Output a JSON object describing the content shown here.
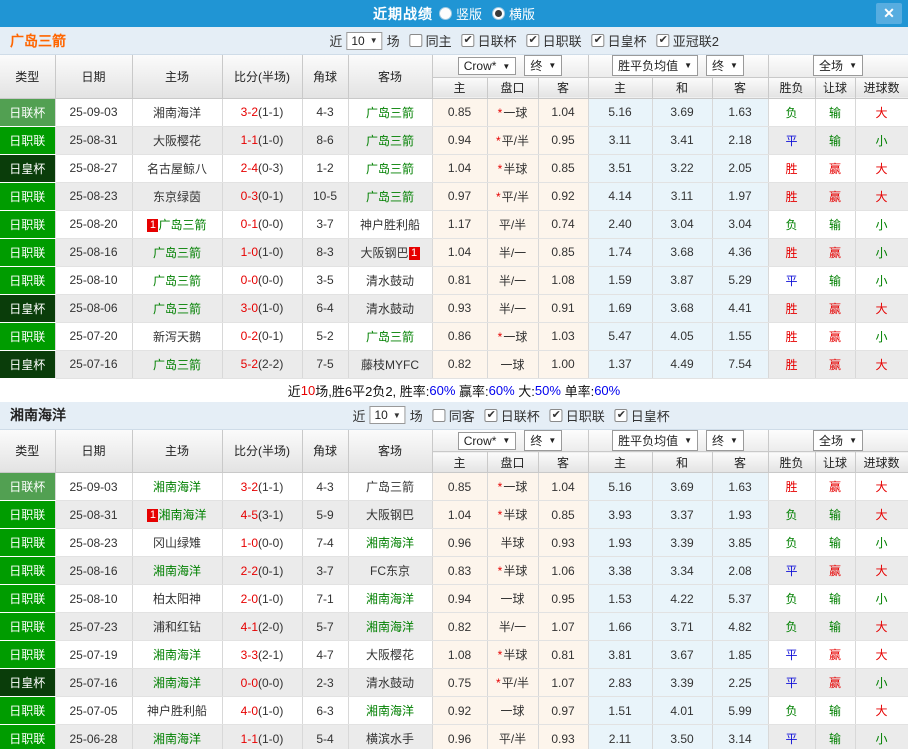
{
  "colors": {
    "titlebar_bg": "#2095d4",
    "close_bg": "#57ade0",
    "filterbar_bg": "#e5eef6",
    "team1_accent": "#ff6600",
    "team2_accent": "#222222",
    "cup1_green": "#52a052",
    "league_green": "#009c00",
    "cup2_darkgreen": "#0a3d0a",
    "crow_col_bg": "#fdf5ec",
    "avg_col_bg": "#e9f4fa",
    "win_red": "#e60000",
    "draw_blue": "#1010d8",
    "lose_green": "#008000"
  },
  "titlebar": {
    "title": "近期战绩",
    "close": "✕",
    "options": [
      {
        "label": "竖版",
        "selected": false
      },
      {
        "label": "横版",
        "selected": true
      }
    ]
  },
  "table_header": {
    "left_cols": [
      "类型",
      "日期",
      "主场",
      "比分(半场)",
      "角球",
      "客场"
    ],
    "group1": {
      "company": "Crow*",
      "final": "终"
    },
    "group2": {
      "company": "胜平负均值",
      "final": "终"
    },
    "group3": {
      "scope": "全场"
    },
    "sub_cols": [
      "主",
      "盘口",
      "客",
      "主",
      "和",
      "客",
      "胜负",
      "让球",
      "进球数"
    ]
  },
  "sections": [
    {
      "team": "广岛三箭",
      "team_color": "#ff6600",
      "filter": {
        "near": "近",
        "count": "10",
        "games": "场",
        "same": "同主",
        "same_checked": false,
        "leagues": [
          {
            "label": "日联杯",
            "checked": true
          },
          {
            "label": "日职联",
            "checked": true
          },
          {
            "label": "日皇杯",
            "checked": true
          },
          {
            "label": "亚冠联2",
            "checked": true
          }
        ]
      },
      "rows": [
        {
          "type": "日联杯",
          "tc": "cup1",
          "date": "25-09-03",
          "home": "湘南海洋",
          "hf": false,
          "hb": "",
          "score": "3-2",
          "half": "(1-1)",
          "corner": "4-3",
          "away": "广岛三箭",
          "af": true,
          "ab": "",
          "c1": "0.85",
          "star": true,
          "hc": "一球",
          "c2": "1.04",
          "a1": "5.16",
          "a2": "3.69",
          "a3": "1.63",
          "r": "负",
          "hr": "输",
          "g": "大"
        },
        {
          "type": "日职联",
          "tc": "lg",
          "date": "25-08-31",
          "home": "大阪樱花",
          "hf": false,
          "hb": "",
          "score": "1-1",
          "half": "(1-0)",
          "corner": "8-6",
          "away": "广岛三箭",
          "af": true,
          "ab": "",
          "c1": "0.94",
          "star": true,
          "hc": "平/半",
          "c2": "0.95",
          "a1": "3.11",
          "a2": "3.41",
          "a3": "2.18",
          "r": "平",
          "hr": "输",
          "g": "小"
        },
        {
          "type": "日皇杯",
          "tc": "cup2",
          "date": "25-08-27",
          "home": "名古屋鲸八",
          "hf": false,
          "hb": "",
          "score": "2-4",
          "half": "(0-3)",
          "corner": "1-2",
          "away": "广岛三箭",
          "af": true,
          "ab": "",
          "c1": "1.04",
          "star": true,
          "hc": "半球",
          "c2": "0.85",
          "a1": "3.51",
          "a2": "3.22",
          "a3": "2.05",
          "r": "胜",
          "hr": "赢",
          "g": "大"
        },
        {
          "type": "日职联",
          "tc": "lg",
          "date": "25-08-23",
          "home": "东京绿茵",
          "hf": false,
          "hb": "",
          "score": "0-3",
          "half": "(0-1)",
          "corner": "10-5",
          "away": "广岛三箭",
          "af": true,
          "ab": "",
          "c1": "0.97",
          "star": true,
          "hc": "平/半",
          "c2": "0.92",
          "a1": "4.14",
          "a2": "3.11",
          "a3": "1.97",
          "r": "胜",
          "hr": "赢",
          "g": "大"
        },
        {
          "type": "日职联",
          "tc": "lg",
          "date": "25-08-20",
          "home": "广岛三箭",
          "hf": true,
          "hb": "1",
          "score": "0-1",
          "half": "(0-0)",
          "corner": "3-7",
          "away": "神户胜利船",
          "af": false,
          "ab": "",
          "c1": "1.17",
          "star": false,
          "hc": "平/半",
          "c2": "0.74",
          "a1": "2.40",
          "a2": "3.04",
          "a3": "3.04",
          "r": "负",
          "hr": "输",
          "g": "小"
        },
        {
          "type": "日职联",
          "tc": "lg",
          "date": "25-08-16",
          "home": "广岛三箭",
          "hf": true,
          "hb": "",
          "score": "1-0",
          "half": "(1-0)",
          "corner": "8-3",
          "away": "大阪钢巴",
          "af": false,
          "ab": "1",
          "c1": "1.04",
          "star": false,
          "hc": "半/一",
          "c2": "0.85",
          "a1": "1.74",
          "a2": "3.68",
          "a3": "4.36",
          "r": "胜",
          "hr": "赢",
          "g": "小"
        },
        {
          "type": "日职联",
          "tc": "lg",
          "date": "25-08-10",
          "home": "广岛三箭",
          "hf": true,
          "hb": "",
          "score": "0-0",
          "half": "(0-0)",
          "corner": "3-5",
          "away": "清水鼓动",
          "af": false,
          "ab": "",
          "c1": "0.81",
          "star": false,
          "hc": "半/一",
          "c2": "1.08",
          "a1": "1.59",
          "a2": "3.87",
          "a3": "5.29",
          "r": "平",
          "hr": "输",
          "g": "小"
        },
        {
          "type": "日皇杯",
          "tc": "cup2",
          "date": "25-08-06",
          "home": "广岛三箭",
          "hf": true,
          "hb": "",
          "score": "3-0",
          "half": "(1-0)",
          "corner": "6-4",
          "away": "清水鼓动",
          "af": false,
          "ab": "",
          "c1": "0.93",
          "star": false,
          "hc": "半/一",
          "c2": "0.91",
          "a1": "1.69",
          "a2": "3.68",
          "a3": "4.41",
          "r": "胜",
          "hr": "赢",
          "g": "大"
        },
        {
          "type": "日职联",
          "tc": "lg",
          "date": "25-07-20",
          "home": "新泻天鹅",
          "hf": false,
          "hb": "",
          "score": "0-2",
          "half": "(0-1)",
          "corner": "5-2",
          "away": "广岛三箭",
          "af": true,
          "ab": "",
          "c1": "0.86",
          "star": true,
          "hc": "一球",
          "c2": "1.03",
          "a1": "5.47",
          "a2": "4.05",
          "a3": "1.55",
          "r": "胜",
          "hr": "赢",
          "g": "小"
        },
        {
          "type": "日皇杯",
          "tc": "cup2",
          "date": "25-07-16",
          "home": "广岛三箭",
          "hf": true,
          "hb": "",
          "score": "5-2",
          "half": "(2-2)",
          "corner": "7-5",
          "away": "藤枝MYFC",
          "af": false,
          "ab": "",
          "c1": "0.82",
          "star": false,
          "hc": "一球",
          "c2": "1.00",
          "a1": "1.37",
          "a2": "4.49",
          "a3": "7.54",
          "r": "胜",
          "hr": "赢",
          "g": "大"
        }
      ],
      "summary_parts": [
        {
          "t": "近",
          "c": "k"
        },
        {
          "t": "10",
          "c": "r"
        },
        {
          "t": "场,胜6平2负2, 胜率:",
          "c": "k"
        },
        {
          "t": "60%",
          "c": "b"
        },
        {
          "t": " 赢率:",
          "c": "k"
        },
        {
          "t": "60%",
          "c": "b"
        },
        {
          "t": " 大:",
          "c": "k"
        },
        {
          "t": "50%",
          "c": "b"
        },
        {
          "t": " 单率:",
          "c": "k"
        },
        {
          "t": "60%",
          "c": "b"
        }
      ]
    },
    {
      "team": "湘南海洋",
      "team_color": "#222222",
      "filter": {
        "near": "近",
        "count": "10",
        "games": "场",
        "same": "同客",
        "same_checked": false,
        "leagues": [
          {
            "label": "日联杯",
            "checked": true
          },
          {
            "label": "日职联",
            "checked": true
          },
          {
            "label": "日皇杯",
            "checked": true
          }
        ]
      },
      "rows": [
        {
          "type": "日联杯",
          "tc": "cup1",
          "date": "25-09-03",
          "home": "湘南海洋",
          "hf": true,
          "hb": "",
          "score": "3-2",
          "half": "(1-1)",
          "corner": "4-3",
          "away": "广岛三箭",
          "af": false,
          "ab": "",
          "c1": "0.85",
          "star": true,
          "hc": "一球",
          "c2": "1.04",
          "a1": "5.16",
          "a2": "3.69",
          "a3": "1.63",
          "r": "胜",
          "hr": "赢",
          "g": "大"
        },
        {
          "type": "日职联",
          "tc": "lg",
          "date": "25-08-31",
          "home": "湘南海洋",
          "hf": true,
          "hb": "1",
          "score": "4-5",
          "half": "(3-1)",
          "corner": "5-9",
          "away": "大阪钢巴",
          "af": false,
          "ab": "",
          "c1": "1.04",
          "star": true,
          "hc": "半球",
          "c2": "0.85",
          "a1": "3.93",
          "a2": "3.37",
          "a3": "1.93",
          "r": "负",
          "hr": "输",
          "g": "大"
        },
        {
          "type": "日职联",
          "tc": "lg",
          "date": "25-08-23",
          "home": "冈山绿雉",
          "hf": false,
          "hb": "",
          "score": "1-0",
          "half": "(0-0)",
          "corner": "7-4",
          "away": "湘南海洋",
          "af": true,
          "ab": "",
          "c1": "0.96",
          "star": false,
          "hc": "半球",
          "c2": "0.93",
          "a1": "1.93",
          "a2": "3.39",
          "a3": "3.85",
          "r": "负",
          "hr": "输",
          "g": "小"
        },
        {
          "type": "日职联",
          "tc": "lg",
          "date": "25-08-16",
          "home": "湘南海洋",
          "hf": true,
          "hb": "",
          "score": "2-2",
          "half": "(0-1)",
          "corner": "3-7",
          "away": "FC东京",
          "af": false,
          "ab": "",
          "c1": "0.83",
          "star": true,
          "hc": "半球",
          "c2": "1.06",
          "a1": "3.38",
          "a2": "3.34",
          "a3": "2.08",
          "r": "平",
          "hr": "赢",
          "g": "大"
        },
        {
          "type": "日职联",
          "tc": "lg",
          "date": "25-08-10",
          "home": "柏太阳神",
          "hf": false,
          "hb": "",
          "score": "2-0",
          "half": "(1-0)",
          "corner": "7-1",
          "away": "湘南海洋",
          "af": true,
          "ab": "",
          "c1": "0.94",
          "star": false,
          "hc": "一球",
          "c2": "0.95",
          "a1": "1.53",
          "a2": "4.22",
          "a3": "5.37",
          "r": "负",
          "hr": "输",
          "g": "小"
        },
        {
          "type": "日职联",
          "tc": "lg",
          "date": "25-07-23",
          "home": "浦和红钻",
          "hf": false,
          "hb": "",
          "score": "4-1",
          "half": "(2-0)",
          "corner": "5-7",
          "away": "湘南海洋",
          "af": true,
          "ab": "",
          "c1": "0.82",
          "star": false,
          "hc": "半/一",
          "c2": "1.07",
          "a1": "1.66",
          "a2": "3.71",
          "a3": "4.82",
          "r": "负",
          "hr": "输",
          "g": "大"
        },
        {
          "type": "日职联",
          "tc": "lg",
          "date": "25-07-19",
          "home": "湘南海洋",
          "hf": true,
          "hb": "",
          "score": "3-3",
          "half": "(2-1)",
          "corner": "4-7",
          "away": "大阪樱花",
          "af": false,
          "ab": "",
          "c1": "1.08",
          "star": true,
          "hc": "半球",
          "c2": "0.81",
          "a1": "3.81",
          "a2": "3.67",
          "a3": "1.85",
          "r": "平",
          "hr": "赢",
          "g": "大"
        },
        {
          "type": "日皇杯",
          "tc": "cup2",
          "date": "25-07-16",
          "home": "湘南海洋",
          "hf": true,
          "hb": "",
          "score": "0-0",
          "half": "(0-0)",
          "corner": "2-3",
          "away": "清水鼓动",
          "af": false,
          "ab": "",
          "c1": "0.75",
          "star": true,
          "hc": "平/半",
          "c2": "1.07",
          "a1": "2.83",
          "a2": "3.39",
          "a3": "2.25",
          "r": "平",
          "hr": "赢",
          "g": "小"
        },
        {
          "type": "日职联",
          "tc": "lg",
          "date": "25-07-05",
          "home": "神户胜利船",
          "hf": false,
          "hb": "",
          "score": "4-0",
          "half": "(1-0)",
          "corner": "6-3",
          "away": "湘南海洋",
          "af": true,
          "ab": "",
          "c1": "0.92",
          "star": false,
          "hc": "一球",
          "c2": "0.97",
          "a1": "1.51",
          "a2": "4.01",
          "a3": "5.99",
          "r": "负",
          "hr": "输",
          "g": "大"
        },
        {
          "type": "日职联",
          "tc": "lg",
          "date": "25-06-28",
          "home": "湘南海洋",
          "hf": true,
          "hb": "",
          "score": "1-1",
          "half": "(1-0)",
          "corner": "5-4",
          "away": "横滨水手",
          "af": false,
          "ab": "",
          "c1": "0.96",
          "star": false,
          "hc": "平/半",
          "c2": "0.93",
          "a1": "2.11",
          "a2": "3.50",
          "a3": "3.14",
          "r": "平",
          "hr": "输",
          "g": "小"
        }
      ]
    }
  ]
}
